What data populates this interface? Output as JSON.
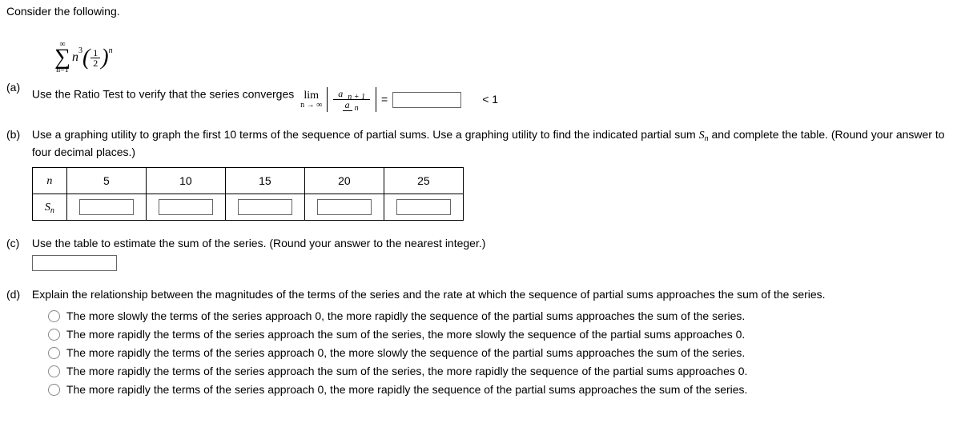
{
  "intro": "Consider the following.",
  "series": {
    "sigma_top": "∞",
    "sigma_bot": "n=1",
    "n_cubed": "n",
    "cubed_exp": "3",
    "frac_num": "1",
    "frac_den": "2",
    "outer_exp": "n"
  },
  "a": {
    "label": "(a)",
    "text": "Use the Ratio Test to verify that the series converges",
    "lim_top": "lim",
    "lim_bot": "n → ∞",
    "anp1_a": "a",
    "anp1_sub": "n + 1",
    "an_a": "a",
    "an_sub": "n",
    "equals": "=",
    "lt1": "< 1"
  },
  "b": {
    "label": "(b)",
    "text_1": "Use a graphing utility to graph the first 10 terms of the sequence of partial sums. Use a graphing utility to find the indicated partial sum ",
    "s_var": "S",
    "s_sub": "n",
    "text_2": " and complete the table. (Round your answer to four decimal places.)",
    "row1_head": "n",
    "cols": [
      "5",
      "10",
      "15",
      "20",
      "25"
    ],
    "row2_head_base": "S",
    "row2_head_sub": "n"
  },
  "c": {
    "label": "(c)",
    "text": "Use the table to estimate the sum of the series. (Round your answer to the nearest integer.)"
  },
  "d": {
    "label": "(d)",
    "text": "Explain the relationship between the magnitudes of the terms of the series and the rate at which the sequence of partial sums approaches the sum of the series.",
    "options": [
      "The more slowly the terms of the series approach 0, the more rapidly the sequence of the partial sums approaches the sum of the series.",
      "The more rapidly the terms of the series approach the sum of the series, the more slowly the sequence of the partial sums approaches 0.",
      "The more rapidly the terms of the series approach 0, the more slowly the sequence of the partial sums approaches the sum of the series.",
      "The more rapidly the terms of the series approach the sum of the series, the more rapidly the sequence of the partial sums approaches 0.",
      "The more rapidly the terms of the series approach 0, the more rapidly the sequence of the partial sums approaches the sum of the series."
    ]
  }
}
